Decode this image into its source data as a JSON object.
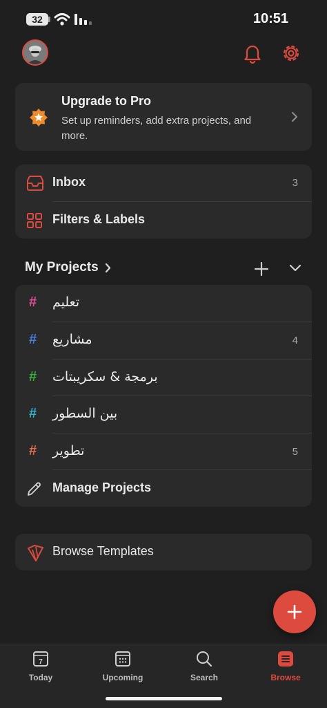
{
  "status_bar": {
    "battery": "32",
    "time": "10:51"
  },
  "header": {
    "avatar_icon": "avatar",
    "notifications_icon": "bell-icon",
    "settings_icon": "gear-icon"
  },
  "upgrade": {
    "title": "Upgrade to Pro",
    "description": "Set up reminders, add extra projects, and more."
  },
  "nav": [
    {
      "label": "Inbox",
      "count": "3",
      "icon": "inbox-icon"
    },
    {
      "label": "Filters & Labels",
      "count": "",
      "icon": "grid-icon"
    }
  ],
  "projects_section": {
    "title": "My Projects"
  },
  "projects": [
    {
      "name": "تعليم",
      "count": "",
      "color": "#e05194"
    },
    {
      "name": "مشاريع",
      "count": "4",
      "color": "#4a7fe0"
    },
    {
      "name": "برمجة & سكريبتات",
      "count": "",
      "color": "#3bae3b"
    },
    {
      "name": "بين السطور",
      "count": "",
      "color": "#2fb2c6"
    },
    {
      "name": "تطوير",
      "count": "5",
      "color": "#e06f52"
    }
  ],
  "manage_projects": {
    "label": "Manage Projects"
  },
  "templates": {
    "label": "Browse Templates"
  },
  "tabs": [
    {
      "label": "Today",
      "icon": "calendar-day-icon",
      "day": "7",
      "active": false
    },
    {
      "label": "Upcoming",
      "icon": "calendar-icon",
      "active": false
    },
    {
      "label": "Search",
      "icon": "search-icon",
      "active": false
    },
    {
      "label": "Browse",
      "icon": "browse-icon",
      "active": true
    }
  ],
  "colors": {
    "accent": "#dd4b3f",
    "background": "#1f1f1f",
    "card": "#2a2a2a"
  }
}
